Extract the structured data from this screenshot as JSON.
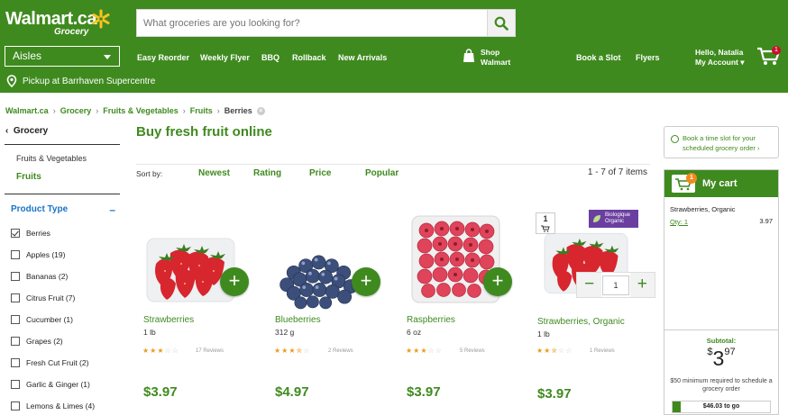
{
  "header": {
    "brand": "Walmart.ca",
    "brand_sub": "Grocery",
    "search_placeholder": "What groceries are you looking for?",
    "aisles_label": "Aisles",
    "nav": [
      "Easy Reorder",
      "Weekly Flyer",
      "BBQ",
      "Rollback",
      "New Arrivals"
    ],
    "shop_line1": "Shop",
    "shop_line2": "Walmart",
    "book_slot": "Book a Slot",
    "flyers": "Flyers",
    "greeting": "Hello, Natalia",
    "my_account": "My Account",
    "cart_count": "1",
    "pickup": "Pickup at Barrhaven Supercentre",
    "colors": {
      "brand_green": "#3f8a1f",
      "link_blue": "#1a73c5",
      "badge_red": "#c8102e"
    }
  },
  "breadcrumb": [
    "Walmart.ca",
    "Grocery",
    "Fruits & Vegetables",
    "Fruits",
    "Berries"
  ],
  "sidebar": {
    "back": "Grocery",
    "categories": [
      "Fruits & Vegetables",
      "Fruits"
    ],
    "filter_title": "Product Type",
    "filters": [
      {
        "label": "Berries",
        "checked": true
      },
      {
        "label": "Apples (19)",
        "checked": false
      },
      {
        "label": "Bananas (2)",
        "checked": false
      },
      {
        "label": "Citrus Fruit (7)",
        "checked": false
      },
      {
        "label": "Cucumber (1)",
        "checked": false
      },
      {
        "label": "Grapes (2)",
        "checked": false
      },
      {
        "label": "Fresh Cut Fruit (2)",
        "checked": false
      },
      {
        "label": "Garlic & Ginger (1)",
        "checked": false
      },
      {
        "label": "Lemons & Limes (4)",
        "checked": false
      }
    ]
  },
  "main": {
    "title": "Buy fresh fruit online",
    "sort_by": "Sort by:",
    "sort_options": [
      "Newest",
      "Rating",
      "Price",
      "Popular"
    ],
    "count": "1 - 7 of 7 items",
    "products": [
      {
        "name": "Strawberries",
        "size": "1 lb",
        "rating": 3,
        "reviews": "17 Reviews",
        "price": "$3.97",
        "image": "strawberries"
      },
      {
        "name": "Blueberries",
        "size": "312 g",
        "rating": 3.5,
        "reviews": "2 Reviews",
        "price": "$4.97",
        "image": "blueberries"
      },
      {
        "name": "Raspberries",
        "size": "6 oz",
        "rating": 3,
        "reviews": "5 Reviews",
        "price": "$3.97",
        "image": "raspberries"
      },
      {
        "name": "Strawberries, Organic",
        "size": "1 lb",
        "rating": 2.5,
        "reviews": "1 Reviews",
        "price": "$3.97",
        "image": "strawberries",
        "in_cart_qty": "1",
        "badge": "Biologique Organic"
      }
    ]
  },
  "cart": {
    "slot_text": "Book a time slot for your scheduled grocery order ›",
    "title": "My cart",
    "badge": "1",
    "item_name": "Strawberries, Organic",
    "item_qty": "Qty: 1",
    "item_price": "3.97",
    "subtotal_label": "Subtotal:",
    "subtotal_dollar": "$",
    "subtotal_whole": "3",
    "subtotal_cents": "97",
    "minimum_note": "$50 minimum required to schedule a grocery order",
    "to_go": "$46.03 to go",
    "progress_fraction": 0.08
  }
}
